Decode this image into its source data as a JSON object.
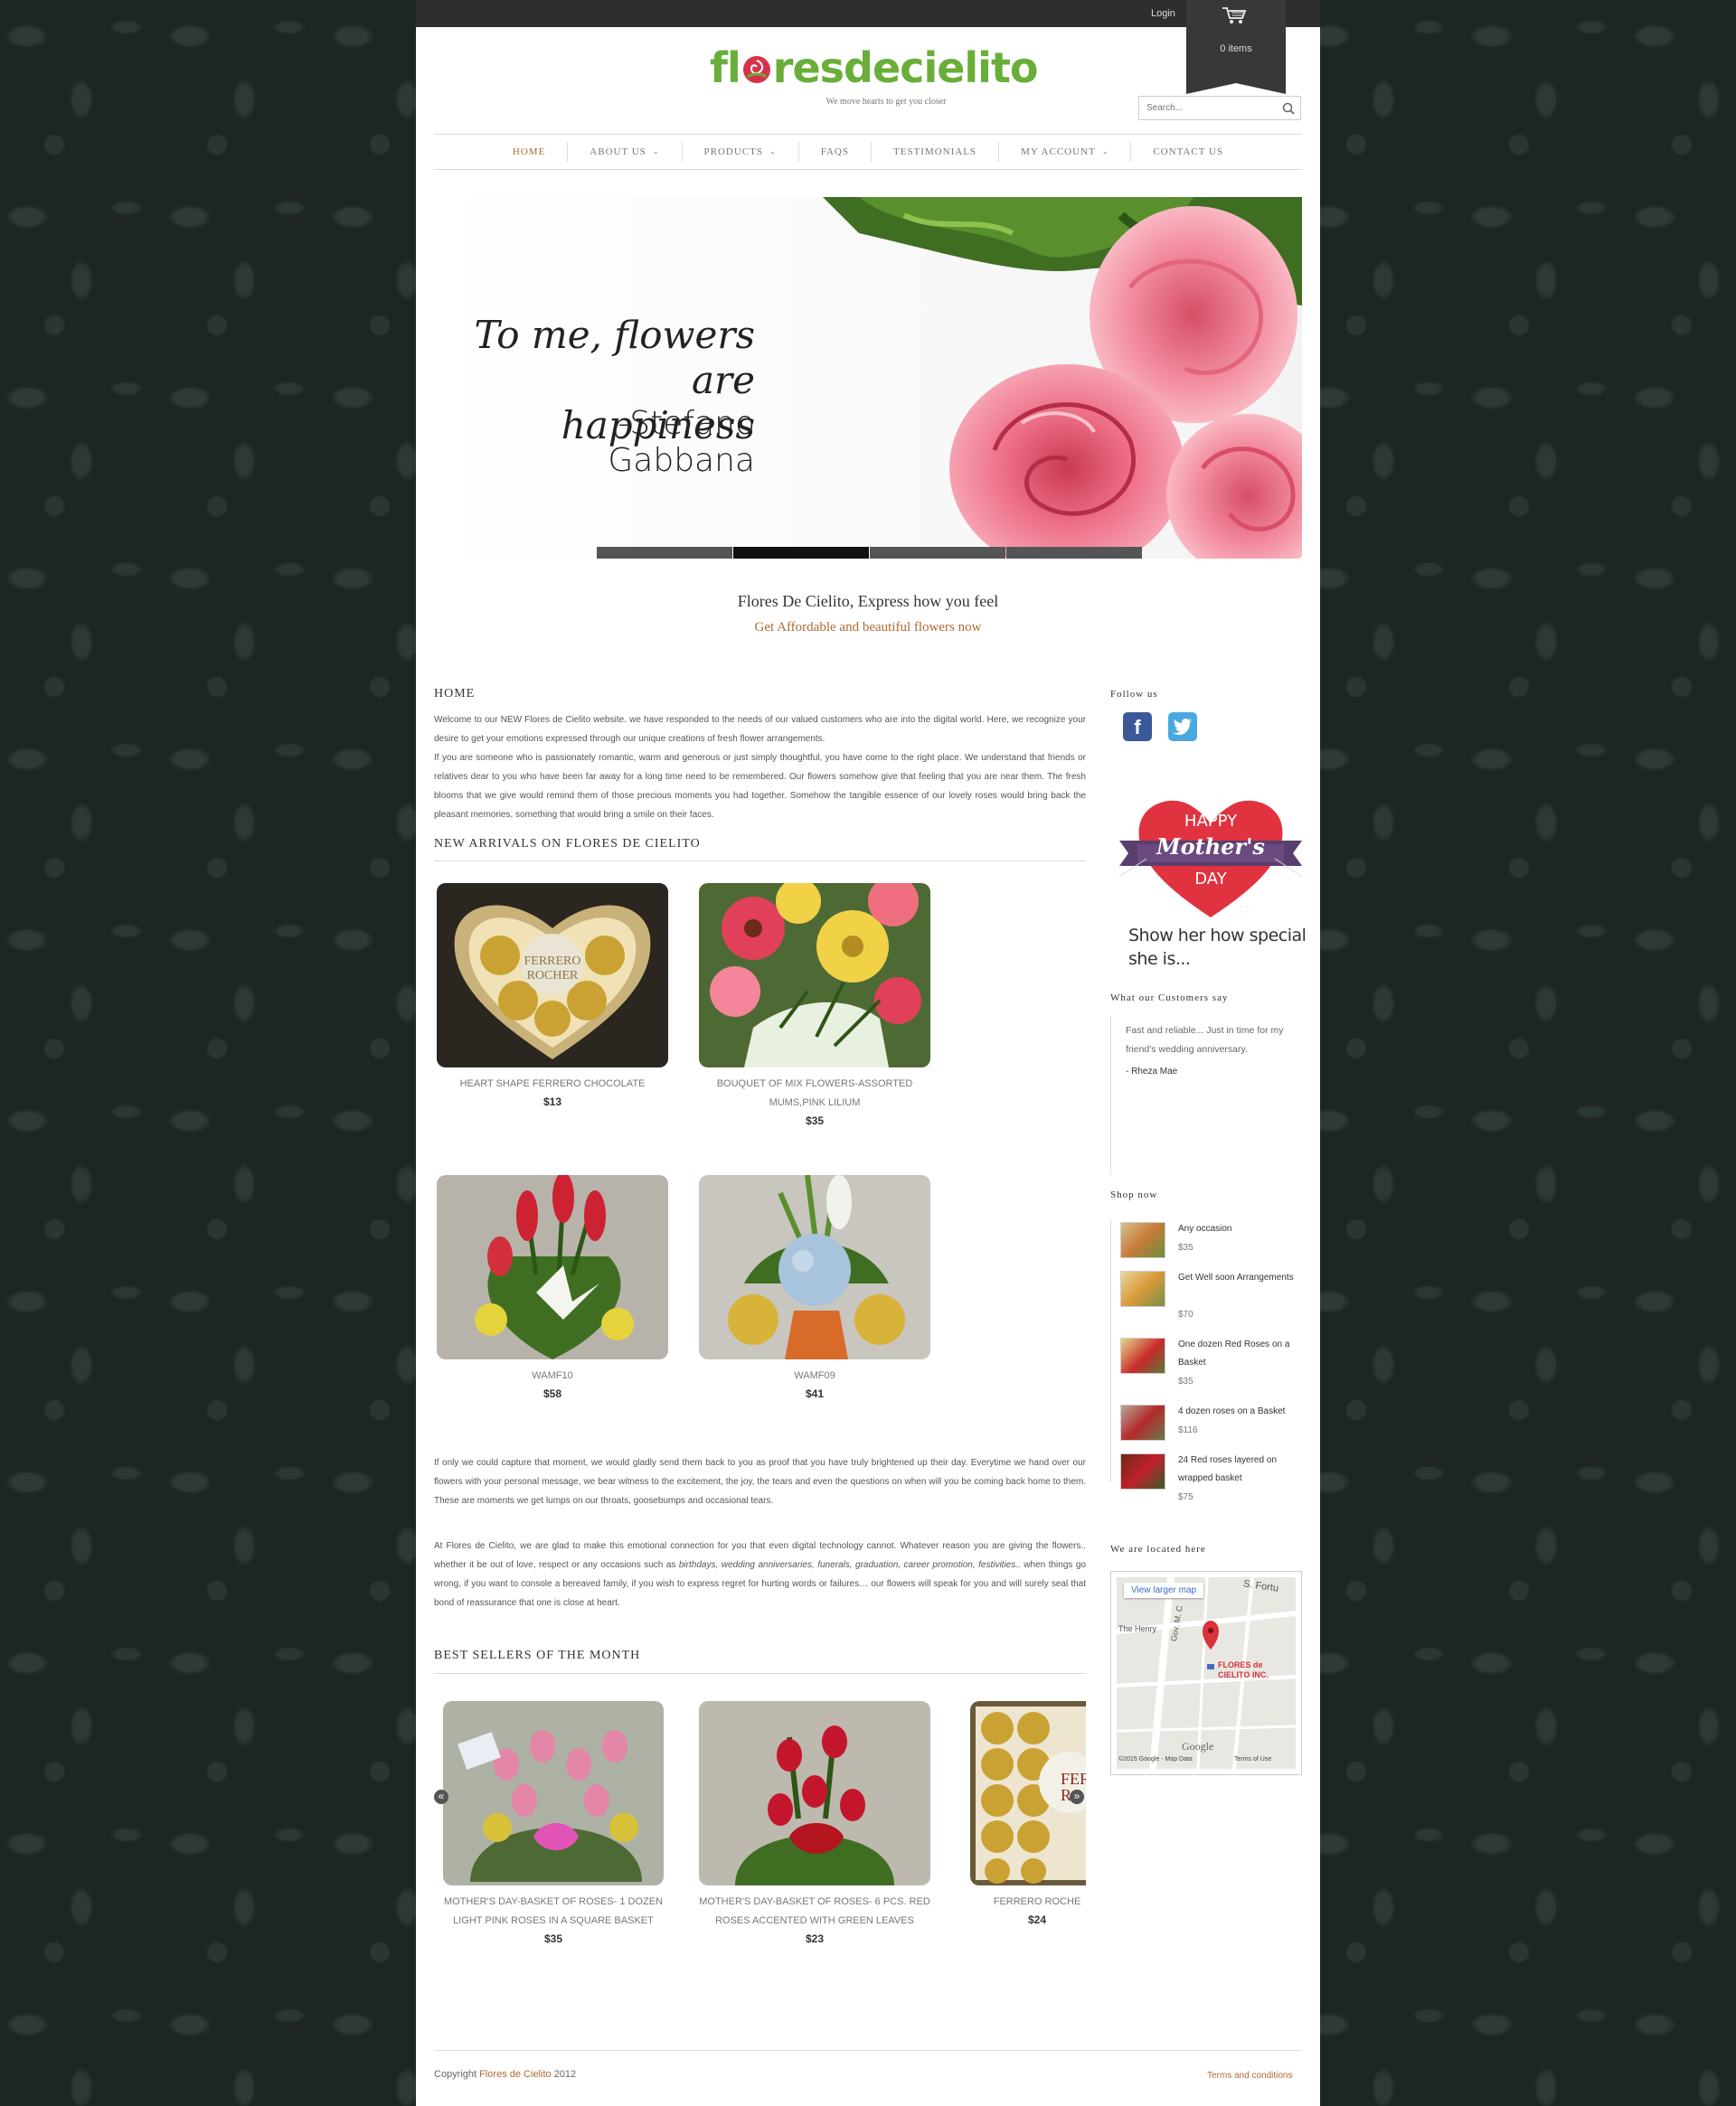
{
  "header": {
    "login": "Login",
    "cart_count": "0 items",
    "logo_prefix": "fl",
    "logo_suffix": "resdecielito",
    "tagline": "We move hearts to get you closer",
    "search_placeholder": "Search..."
  },
  "nav": [
    {
      "label": "HOME",
      "active": true,
      "dropdown": false
    },
    {
      "label": "ABOUT US",
      "active": false,
      "dropdown": true
    },
    {
      "label": "PRODUCTS",
      "active": false,
      "dropdown": true
    },
    {
      "label": "FAQS",
      "active": false,
      "dropdown": false
    },
    {
      "label": "TESTIMONIALS",
      "active": false,
      "dropdown": false
    },
    {
      "label": "MY ACCOUNT",
      "active": false,
      "dropdown": true
    },
    {
      "label": "CONTACT US",
      "active": false,
      "dropdown": false
    }
  ],
  "hero": {
    "quote_line1": "To me, flowers are",
    "quote_line2": "happiness",
    "author": "-Stefano Gabbana",
    "slides": 4,
    "active_slide": 2
  },
  "intro": {
    "title": "Flores De Cielito, Express how you feel",
    "subtitle": "Get Affordable and beautiful flowers now"
  },
  "home": {
    "heading": "HOME",
    "paragraph1": "Welcome to our NEW Flores de Cielito website. we have responded to the needs of our valued customers who are into the digital world. Here, we recognize your desire to get your emotions expressed through our unique creations of fresh flower arrangements.",
    "paragraph2": "If you are someone who is passionately romantic, warm and generous or just simply thoughtful, you have come to the right place. We understand that friends or relatives dear to you who have been far away for a long time need to be remembered. Our flowers somehow give that feeling that you are near them. The fresh blooms that we give would remind them of those precious moments you had together. Somehow the tangible essence of our lovely roses would bring back the pleasant memories, something that would bring a smile on their faces."
  },
  "new_arrivals": {
    "heading": "NEW ARRIVALS ON FLORES DE CIELITO",
    "items": [
      {
        "name": "HEART SHAPE FERRERO CHOCOLATE",
        "price": "$13"
      },
      {
        "name": "BOUQUET OF MIX FLOWERS-ASSORTED MUMS,PINK LILIUM",
        "price": "$35"
      },
      {
        "name": "WAMF10",
        "price": "$58"
      },
      {
        "name": "WAMF09",
        "price": "$41"
      }
    ]
  },
  "story": {
    "paragraph1": "If only we could capture that moment, we would gladly send them back to you as proof that you have truly brightened up their day. Everytime we hand over our flowers with your personal message, we bear witness to the excitement, the joy, the tears and even the questions on when will you be coming back home to them. These are moments we get lumps on our throats, goosebumps and occasional tears.",
    "paragraph2_a": "At Flores de Cielito, we are glad to make this emotional connection for you that even digital technology cannot. Whatever reason you are giving the flowers.. whether it be out of love, respect or any occasions such as ",
    "paragraph2_em": "birthdays, wedding anniversaries, funerals, graduation, career promotion, festivities..",
    "paragraph2_b": " when things go wrong, if you want to console a bereaved family, if you wish to express regret for hurting words or failures… our flowers will speak for you and will surely seal that bond of reassurance that one is close at heart."
  },
  "best_sellers": {
    "heading": "BEST SELLERS OF THE MONTH",
    "items": [
      {
        "name": "MOTHER'S DAY-BASKET OF ROSES- 1 DOZEN LIGHT PINK ROSES IN A SQUARE BASKET",
        "price": "$35"
      },
      {
        "name": "MOTHER'S DAY-BASKET OF ROSES- 6 PCS. RED ROSES ACCENTED WITH GREEN LEAVES",
        "price": "$23"
      },
      {
        "name": "FERRERO ROCHE",
        "price": "$24"
      }
    ]
  },
  "sidebar": {
    "follow_title": "Follow us",
    "promo_happy": "HAPPY",
    "promo_mothers": "Mother's",
    "promo_day": "DAY",
    "promo_text": "Show her how special she is...",
    "testimonial_title": "What our Customers say",
    "testimonial_text": "Fast and reliable... Just in time for my friend's wedding anniversary.",
    "testimonial_author": "- Rheza Mae",
    "shop_title": "Shop now",
    "shop_items": [
      {
        "name": "Any occasion",
        "price": "$35"
      },
      {
        "name": "Get Well soon Arrangements",
        "price": "$70"
      },
      {
        "name": "One dozen Red Roses on a Basket",
        "price": "$35"
      },
      {
        "name": "4 dozen roses on a Basket",
        "price": "$116"
      },
      {
        "name": "24 Red roses layered on wrapped basket",
        "price": "$75"
      }
    ],
    "map_title": "We are located here",
    "map_link": "View larger map",
    "map_street1": "The Henry",
    "map_street2": "Gov. M. C",
    "map_street3": "S. Fortu",
    "map_marker": "FLORES de CIELITO INC.",
    "map_google": "Google",
    "map_copy": "©2015 Google - Map Data",
    "map_terms": "Terms of Use"
  },
  "footer": {
    "copyright_prefix": "Copyright ",
    "copyright_brand": "Flores de Cielito",
    "copyright_year": " 2012",
    "terms": "Terms and conditions"
  },
  "colors": {
    "accent": "#b06a32",
    "logo_green": "#6aae3a",
    "logo_red": "#d8324b",
    "page_bg": "#1e2624"
  }
}
